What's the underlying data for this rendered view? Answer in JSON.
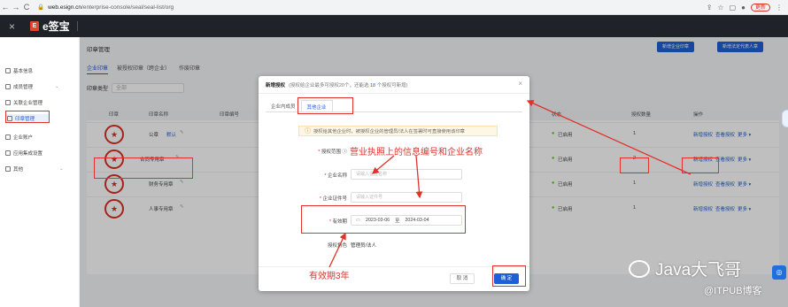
{
  "browser": {
    "url_host": "web.esign.cn",
    "url_path": "/enterprise-console/seal/seal-list/org",
    "update_label": "更新"
  },
  "appbar": {
    "close_glyph": "×",
    "logo_text": "e签宝",
    "logo_mark": "E"
  },
  "sidebar": {
    "items": [
      {
        "label": "基本信息"
      },
      {
        "label": "成员管理"
      },
      {
        "label": "关联企业管理"
      },
      {
        "label": "印章管理"
      },
      {
        "label": "企业账户"
      },
      {
        "label": "应用集成设置"
      },
      {
        "label": "其他"
      }
    ]
  },
  "page": {
    "title": "印章管理",
    "tabs": [
      "企业印章",
      "被授权印章（跨企业）",
      "作废印章"
    ],
    "filter_label": "印章类型",
    "filter_value": "全部",
    "header_buttons": [
      "新增企业印章",
      "新增法定代表人章"
    ]
  },
  "table": {
    "headers": [
      "印章",
      "印章名称",
      "印章编号",
      "状态",
      "授权数量",
      "操作"
    ],
    "rows": [
      {
        "name": "公章",
        "tag": "默认",
        "status": "已启用",
        "count": "1"
      },
      {
        "name": "合同专用章",
        "tag": "",
        "status": "已启用",
        "count": "2"
      },
      {
        "name": "财务专用章",
        "tag": "",
        "status": "已启用",
        "count": "1"
      },
      {
        "name": "人事专用章",
        "tag": "",
        "status": "已启用",
        "count": "1"
      }
    ],
    "actions": [
      "新增授权",
      "查看授权",
      "更多 ▾"
    ]
  },
  "modal": {
    "title": "新增授权",
    "hint_pre": "(授权给企业最多可授权20个，还能选",
    "hint_num": "18",
    "hint_post": "个授权可新增)",
    "tabs": [
      "企业内成员",
      "其他企业"
    ],
    "notice": "授权给其他企业时，被授权企业的管理员/法人在签署时可直接使用该印章",
    "fields": {
      "scope_label": "授权范围",
      "company_name_label": "企业名称",
      "company_name_placeholder": "请输入企业名称",
      "company_cert_label": "企业证件号",
      "company_cert_placeholder": "请输入证件号",
      "validity_label": "有效期",
      "date_start": "2023-03-06",
      "date_sep": "至",
      "date_end": "2024-03-04",
      "role_label": "授权角色",
      "role_value": "管理员/法人"
    },
    "cancel_label": "取 消",
    "ok_label": "确 定"
  },
  "annotations": {
    "note_license": "营业执照上的信息编号和企业名称",
    "note_validity": "有效期3年"
  },
  "watermark": {
    "brand": "Java大飞哥",
    "source": "@ITPUB博客"
  },
  "colors": {
    "primary": "#1f5fd6",
    "annotation_red": "#e0312a",
    "appbar": "#20222a"
  }
}
